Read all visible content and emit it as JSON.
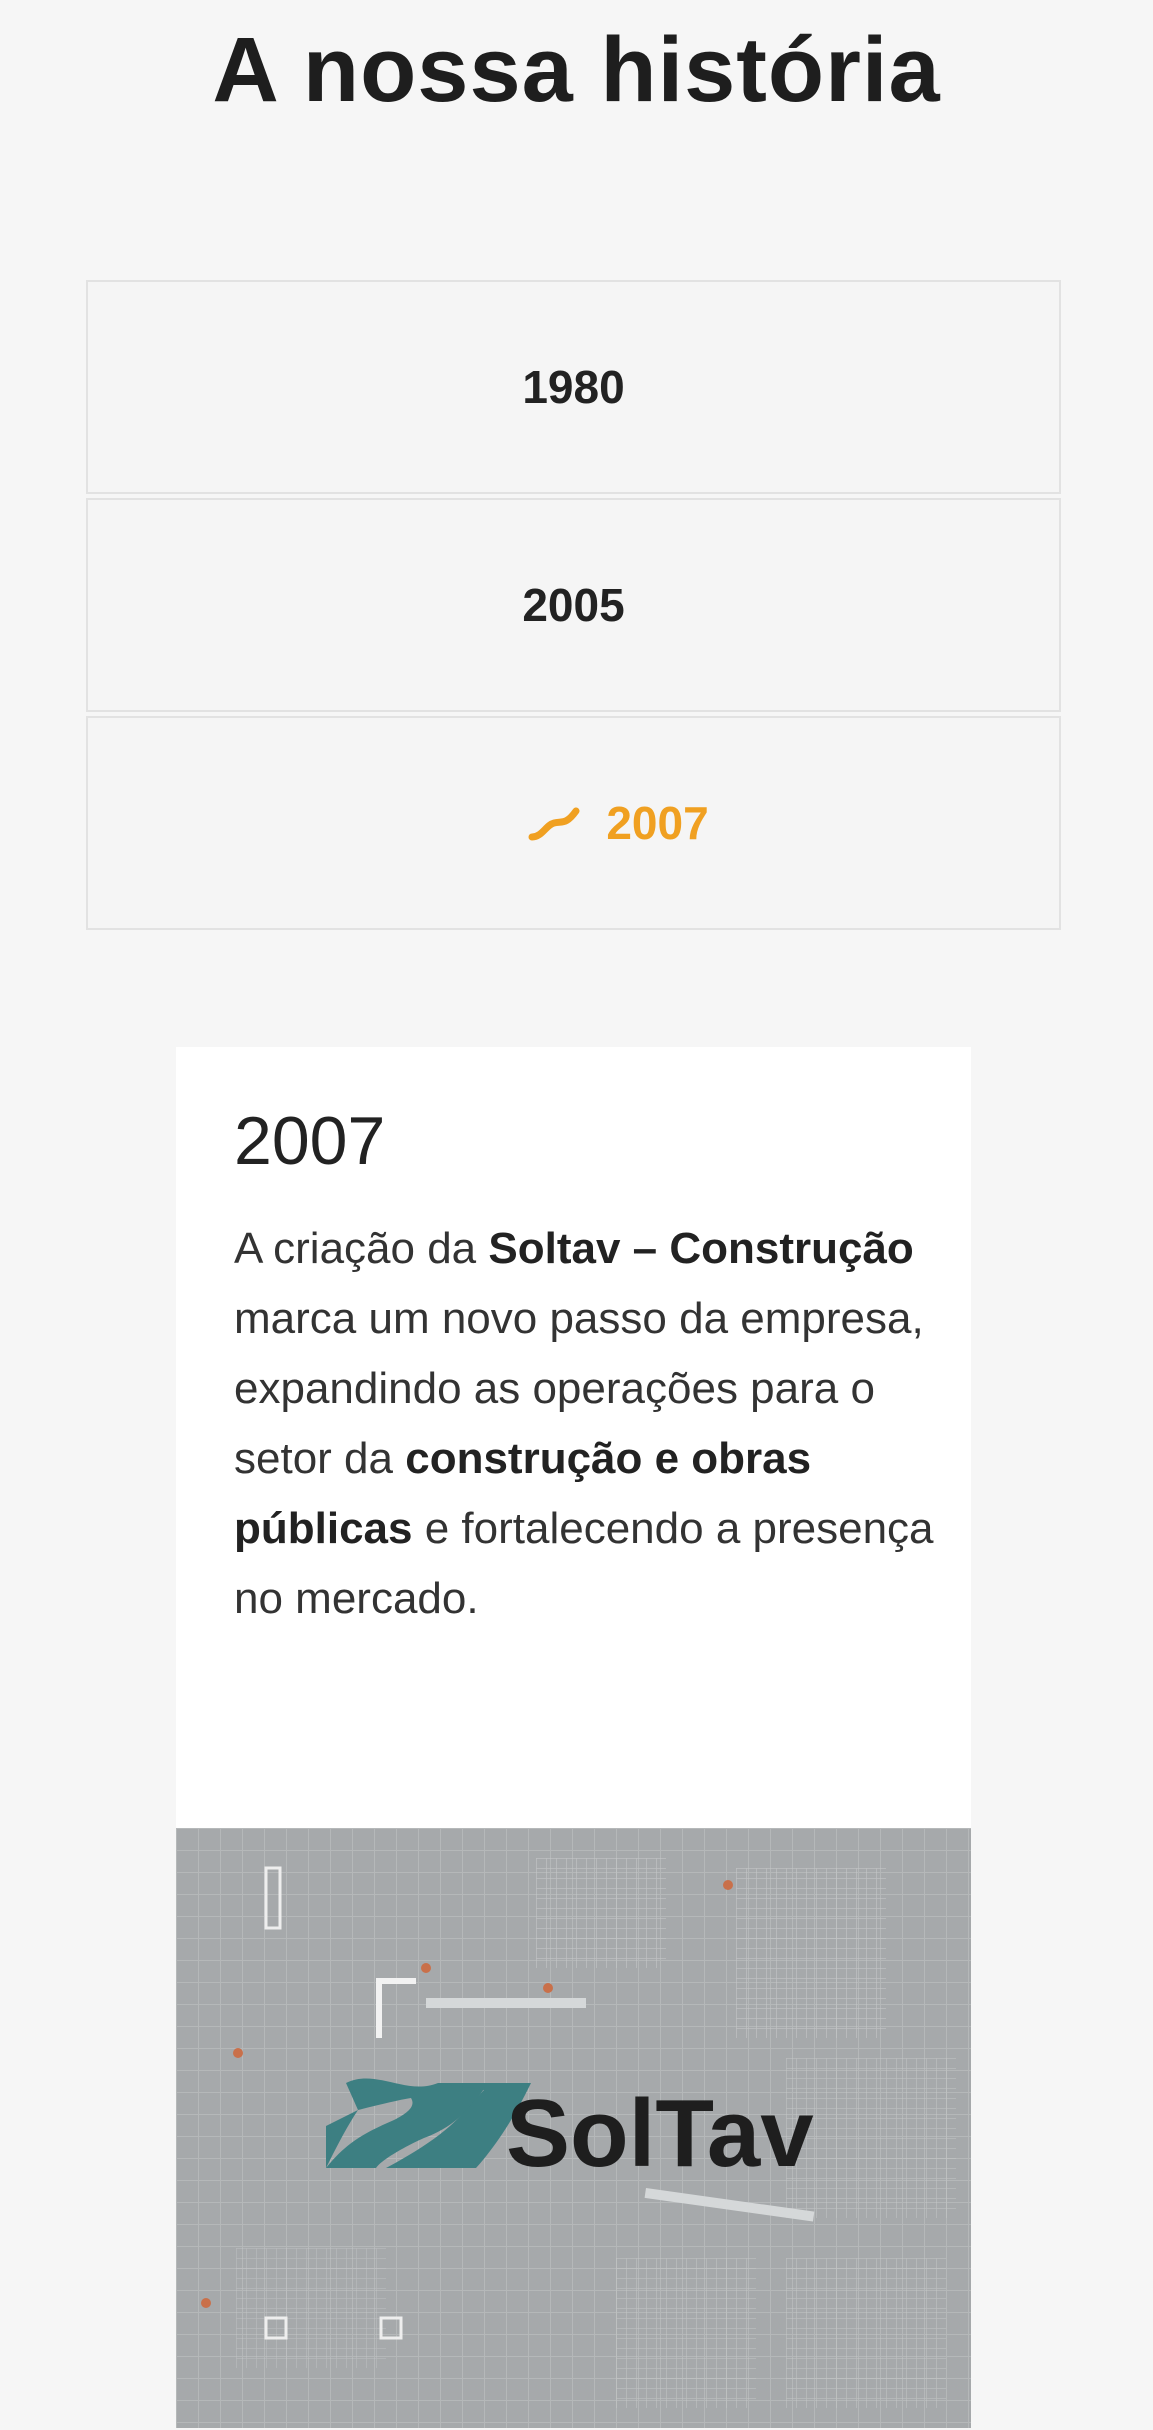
{
  "page": {
    "title": "A nossa história"
  },
  "timeline": {
    "tabs": [
      {
        "label": "1980",
        "active": false
      },
      {
        "label": "2005",
        "active": false
      },
      {
        "label": "2007",
        "active": true,
        "icon": "tilde-icon"
      }
    ],
    "accent_color": "#f0a021"
  },
  "detail": {
    "year": "2007",
    "text": {
      "p1": "A criação da ",
      "b1": "Soltav – Construção",
      "p2": " marca um novo passo da empresa, expandindo as operações para o setor da ",
      "b2": "construção e obras públicas",
      "p3": " e fortalecendo a presença no mercado."
    },
    "image": {
      "logo_text": "SolTav",
      "logo_color": "#3d7f82"
    }
  }
}
